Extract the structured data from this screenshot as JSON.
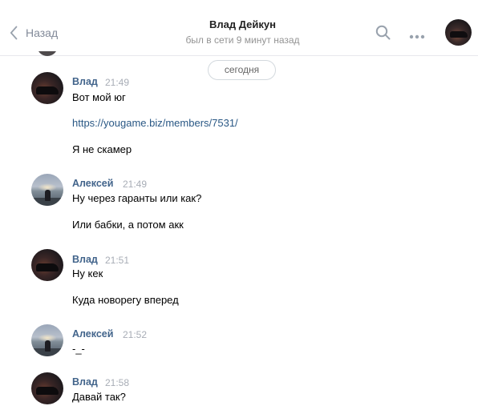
{
  "header": {
    "back_label": "Назад",
    "title": "Влад Дейкун",
    "status": "был в сети 9 минут назад"
  },
  "date_divider": "сегодня",
  "messages": [
    {
      "author": "Влад",
      "time": "21:49",
      "lines": [
        "Вот мой юг",
        "https://yougame.biz/members/7531/",
        "Я не скамер"
      ]
    },
    {
      "author": "Алексей",
      "time": "21:49",
      "lines": [
        "Ну через гаранты или как?",
        "Или бабки, а потом акк"
      ]
    },
    {
      "author": "Влад",
      "time": "21:51",
      "lines": [
        "Ну кек",
        "Куда новорегу вперед"
      ]
    },
    {
      "author": "Алексей",
      "time": "21:52",
      "lines": [
        "-_-"
      ]
    },
    {
      "author": "Влад",
      "time": "21:58",
      "lines": [
        "Давай так?"
      ]
    }
  ],
  "icons": {
    "back": "chevron-left-icon",
    "search": "search-icon",
    "more": "more-dots-icon"
  }
}
